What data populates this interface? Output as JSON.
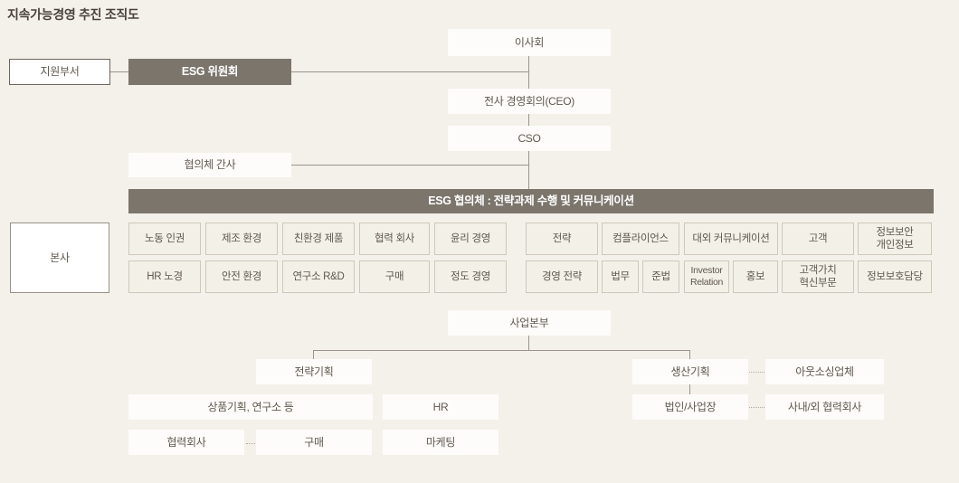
{
  "title": "지속가능경영 추진 조직도",
  "colors": {
    "background": "#f4f1ea",
    "dark_fill": "#7b756c",
    "cell_fill": "#f3f0e8",
    "cell_border": "#cfc8ba",
    "line": "#9c948a",
    "text": "#5f584e"
  },
  "top": {
    "support_dept": "지원부서",
    "esg_committee": "ESG 위원회",
    "board": "이사회",
    "ceo_meeting": "전사 경영회의(CEO)",
    "cso": "CSO",
    "council_secretary": "협의체 간사",
    "esg_council_bar": "ESG 협의체 : 전략과제 수행 및 커뮤니케이션"
  },
  "grid": {
    "headquarters": "본사",
    "groups": [
      {
        "columns": [
          {
            "top": "노동 인권",
            "bottom": [
              "HR 노경"
            ]
          },
          {
            "top": "제조 환경",
            "bottom": [
              "안전 환경"
            ]
          },
          {
            "top": "친환경 제품",
            "bottom": [
              "연구소 R&D"
            ]
          },
          {
            "top": "협력 회사",
            "bottom": [
              "구매"
            ]
          },
          {
            "top": "윤리 경영",
            "bottom": [
              "정도 경영"
            ]
          }
        ]
      },
      {
        "columns": [
          {
            "top": "전략",
            "bottom": [
              "경영 전략"
            ]
          },
          {
            "top": "컴플라이언스",
            "bottom": [
              "법무",
              "준법"
            ]
          },
          {
            "top": "대외 커뮤니케이션",
            "bottom": [
              "Investor\nRelation",
              "홍보"
            ]
          },
          {
            "top": "고객",
            "bottom": [
              "고객가치\n혁신부문"
            ]
          },
          {
            "top": "정보보안\n개인정보",
            "bottom": [
              "정보보호담당"
            ]
          }
        ]
      }
    ]
  },
  "bottom": {
    "business_div": "사업본부",
    "left_branch": {
      "head": "전략기획",
      "rows": [
        {
          "wide": "상품기획, 연구소 등",
          "side": "HR"
        },
        {
          "left": "협력회사",
          "mid": "구매",
          "side": "마케팅"
        }
      ]
    },
    "right_branch": {
      "head": "생산기획",
      "head_partner": "아웃소싱업체",
      "sub": "법인/사업장",
      "sub_partner": "사내/외 협력회사"
    }
  }
}
